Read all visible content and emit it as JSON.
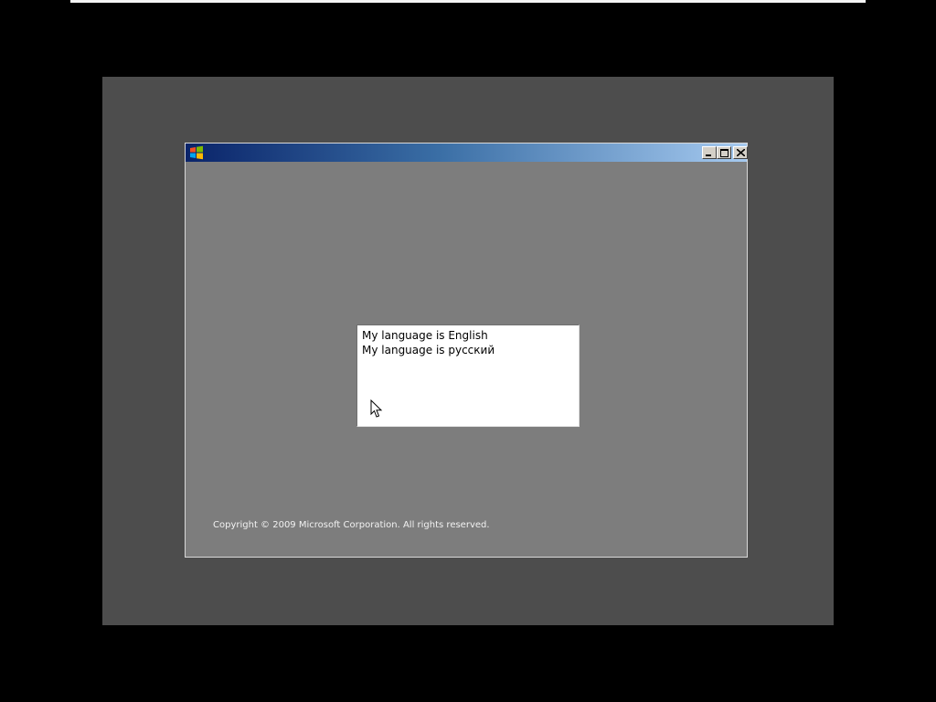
{
  "window": {
    "title": "",
    "controls": {
      "minimize": "minimize-icon",
      "maximize": "maximize-icon",
      "close": "close-icon"
    }
  },
  "language_list": {
    "items": [
      {
        "label": "My language is English"
      },
      {
        "label": "My language is русский"
      }
    ]
  },
  "footer": {
    "copyright": "Copyright © 2009 Microsoft Corporation. All rights reserved."
  },
  "colors": {
    "desktop": "#4d4d4d",
    "window_body": "#7d7d7d",
    "titlebar_start": "#0a246a",
    "titlebar_end": "#a6caf0",
    "list_background": "#ffffff"
  }
}
